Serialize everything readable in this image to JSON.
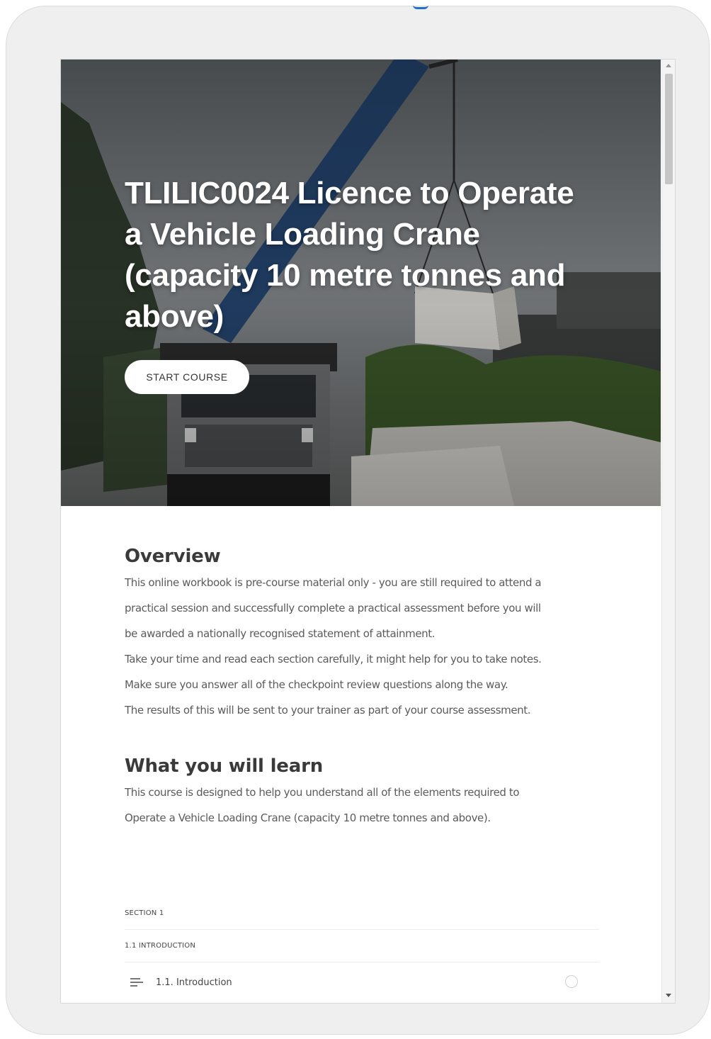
{
  "hero": {
    "title": "TLILIC0024 Licence to Operate a Vehicle Loading Crane (capacity 10 metre tonnes and above)",
    "start_button": "START COURSE"
  },
  "overview": {
    "heading": "Overview",
    "lines": [
      "This online workbook is pre-course material only - you are still required to attend a",
      "practical session and successfully complete a practical assessment before you will",
      "be awarded a nationally recognised statement of attainment.",
      "Take your time and read each section carefully, it might help for you to take notes.",
      "Make sure you answer all of the checkpoint review questions along the way.",
      "The results of this will be sent to your trainer as part of your course assessment."
    ]
  },
  "learn": {
    "heading": "What you will learn",
    "lines": [
      "This course is designed to help you understand all of the elements required to",
      "Operate a Vehicle Loading Crane (capacity 10 metre tonnes and above)."
    ]
  },
  "outline": {
    "section_label": "SECTION 1",
    "subsection_label": "1.1 INTRODUCTION",
    "lessons": [
      {
        "title": "1.1. Introduction",
        "icon": "text-lines-icon",
        "status_icon": "incomplete-circle-icon"
      }
    ]
  },
  "colors": {
    "frame": "#efefef",
    "accent": "#1f6fd1",
    "button_bg": "#ffffff"
  }
}
